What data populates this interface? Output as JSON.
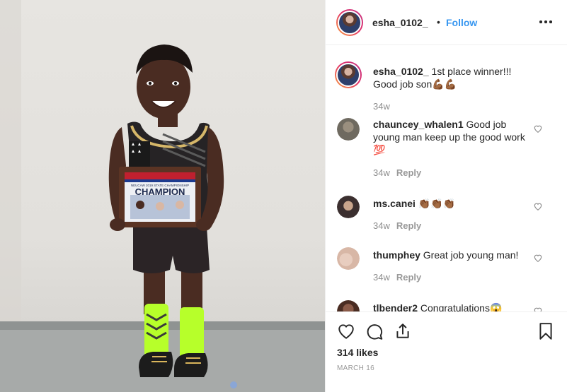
{
  "post": {
    "author": "esha_0102_",
    "follow_label": "Follow",
    "separator": "•",
    "caption_author": "esha_0102_",
    "caption_text": "1st place winner!!! Good job son💪🏾💪🏾",
    "caption_time": "34w"
  },
  "photo": {
    "plaque_title": "CHAMPION",
    "plaque_subtitle": "NEUCAW 2019 STATE CHAMPIONSHIP"
  },
  "comments": [
    {
      "username": "chauncey_whalen1",
      "text": "Good job young man keep up the good work 💯",
      "time": "34w",
      "reply": "Reply",
      "avatar_color": "#6f6a60"
    },
    {
      "username": "ms.canei",
      "text": "👏🏾👏🏾👏🏾",
      "time": "34w",
      "reply": "Reply",
      "avatar_color": "#3b2f2f"
    },
    {
      "username": "thumphey",
      "text": "Great job young man!",
      "time": "34w",
      "reply": "Reply",
      "avatar_color": "#d8b7a6"
    },
    {
      "username": "tlbender2",
      "text": "Congratulations😱",
      "time": "",
      "reply": "",
      "avatar_color": "#4a2c22"
    }
  ],
  "footer": {
    "likes": "314 likes",
    "date": "MARCH 16"
  },
  "icons": [
    "more-options-icon",
    "heart-icon",
    "comment-icon",
    "share-icon",
    "bookmark-icon",
    "like-comment-icon"
  ],
  "colors": {
    "link": "#3897f0",
    "muted": "#8e8e8e",
    "text": "#262626",
    "border": "#efefef"
  }
}
